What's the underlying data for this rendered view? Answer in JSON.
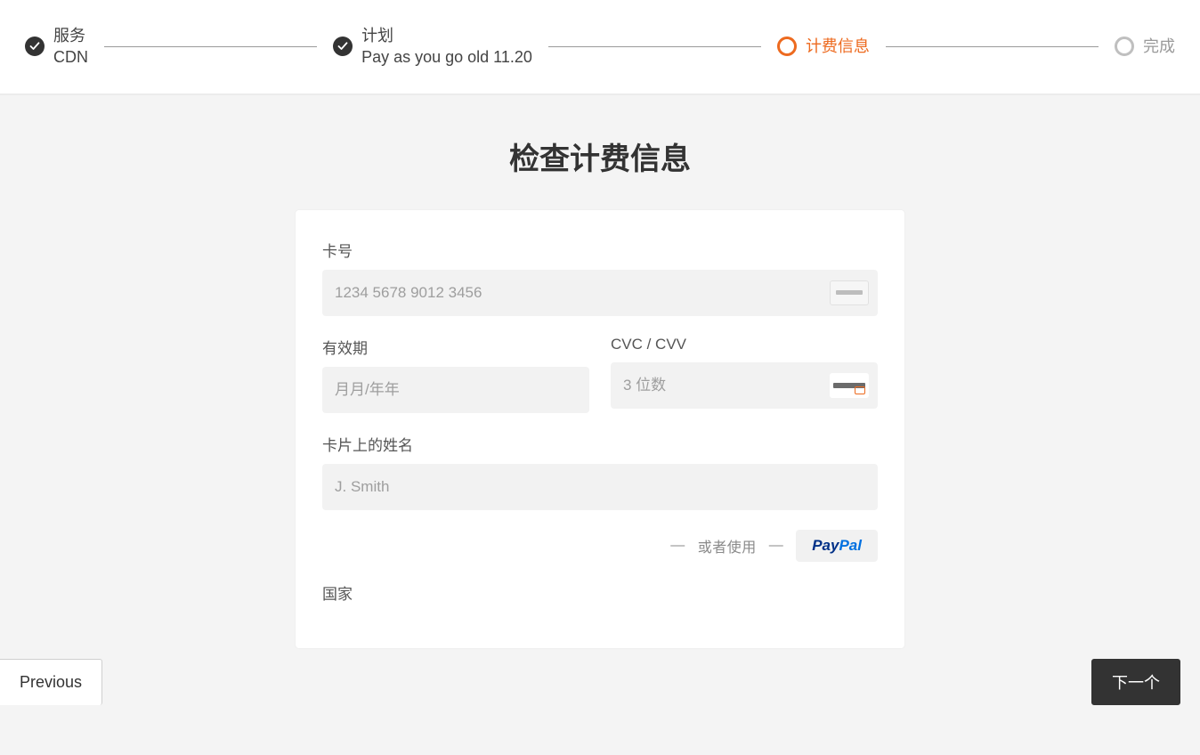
{
  "stepper": {
    "steps": [
      {
        "title": "服务",
        "sub": "CDN",
        "state": "done"
      },
      {
        "title": "计划",
        "sub": "Pay as you go old 11.20",
        "state": "done"
      },
      {
        "title": "计费信息",
        "sub": "",
        "state": "current"
      },
      {
        "title": "完成",
        "sub": "",
        "state": "pending"
      }
    ]
  },
  "page": {
    "title": "检查计费信息"
  },
  "form": {
    "card_number": {
      "label": "卡号",
      "placeholder": "1234 5678 9012 3456",
      "value": ""
    },
    "expiry": {
      "label": "有效期",
      "placeholder": "月月/年年",
      "value": ""
    },
    "cvc": {
      "label": "CVC / CVV",
      "placeholder": "3 位数",
      "value": ""
    },
    "name": {
      "label": "卡片上的姓名",
      "placeholder": "J. Smith",
      "value": ""
    },
    "or_text_left": "—",
    "or_text": "或者使用",
    "or_text_right": "—",
    "paypal_pay": "Pay",
    "paypal_pal": "Pal",
    "country": {
      "label": "国家"
    }
  },
  "footer": {
    "previous": "Previous",
    "next": "下一个"
  },
  "colors": {
    "accent": "#ed6a1f",
    "bg": "#f4f4f4",
    "input_bg": "#f2f2f2"
  }
}
